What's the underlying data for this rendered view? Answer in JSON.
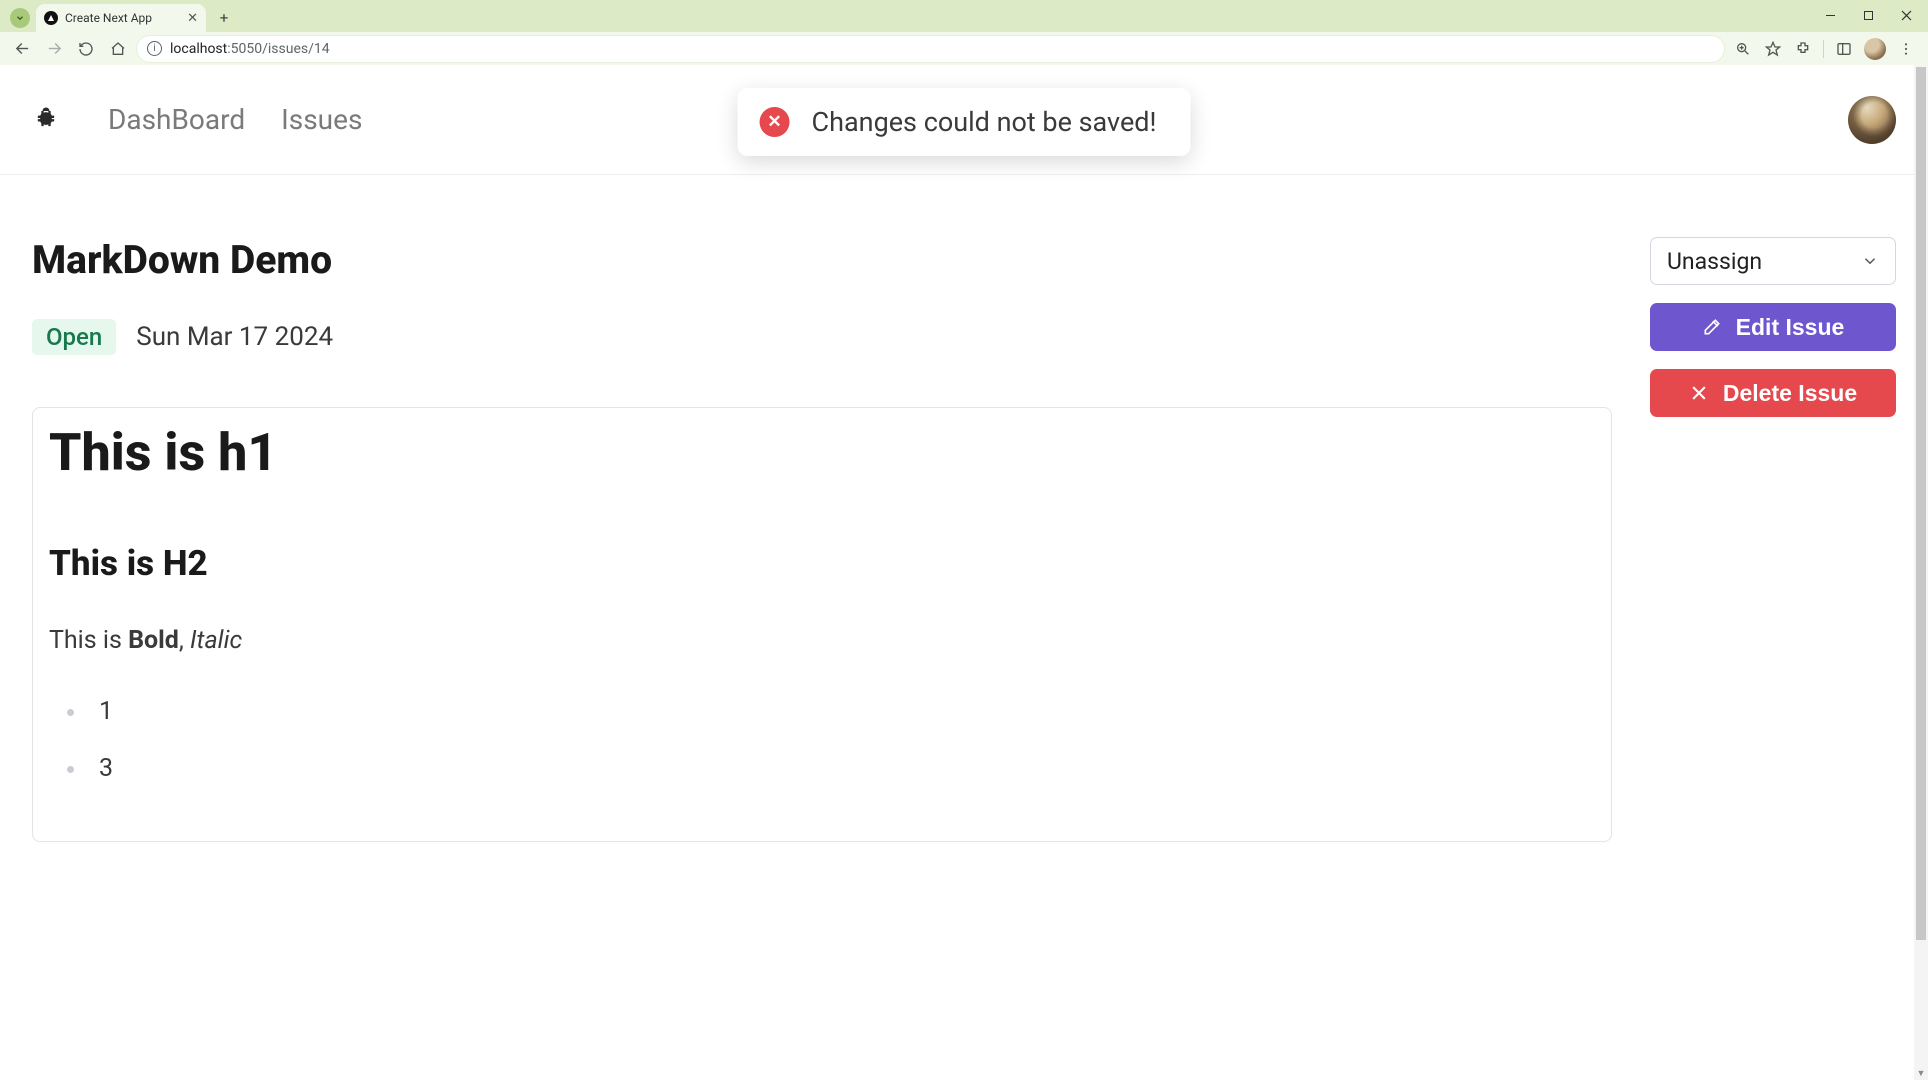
{
  "browser": {
    "tab_title": "Create Next App",
    "url_host": "localhost",
    "url_path": ":5050/issues/14"
  },
  "nav": {
    "dashboard": "DashBoard",
    "issues": "Issues"
  },
  "toast": {
    "message": "Changes could not be saved!"
  },
  "issue": {
    "title": "MarkDown Demo",
    "status": "Open",
    "date": "Sun Mar 17 2024",
    "content": {
      "h1": "This is h1",
      "h2": "This is H2",
      "p_prefix": "This is ",
      "p_bold": "Bold",
      "p_sep": ", ",
      "p_italic": "Italic",
      "list": [
        "1",
        "3"
      ]
    }
  },
  "sidebar": {
    "assignee_select": "Unassign",
    "edit_label": "Edit Issue",
    "delete_label": "Delete Issue"
  }
}
